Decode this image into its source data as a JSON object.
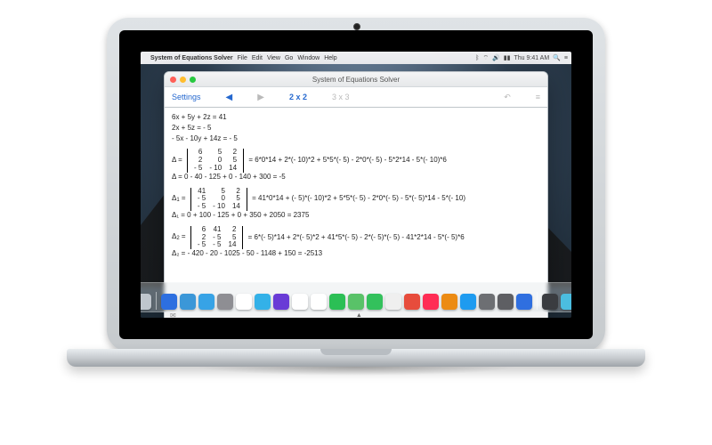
{
  "menubar": {
    "app_name": "System of Equations Solver",
    "menus": [
      "File",
      "Edit",
      "View",
      "Go",
      "Window",
      "Help"
    ],
    "right_status": {
      "time": "Thu 9:41 AM",
      "icons": [
        "bluetooth",
        "wifi",
        "speaker",
        "battery"
      ]
    }
  },
  "window": {
    "title": "System of Equations Solver",
    "toolbar": {
      "settings": "Settings",
      "back_icon": "◀",
      "fwd_icon": "▶",
      "mode_active": "2 x 2",
      "mode_inactive": "3 x 3",
      "undo_icon": "↶",
      "more_icon": "≡"
    },
    "content": {
      "system": [
        "6x + 5y + 2z = 41",
        "2x + 5z = - 5",
        "- 5x - 10y + 14z = - 5"
      ],
      "delta": {
        "label": "Δ =",
        "matrix": [
          [
            "6",
            "5",
            "2"
          ],
          [
            "2",
            "0",
            "5"
          ],
          [
            "- 5",
            "- 10",
            "14"
          ]
        ],
        "expansion": "= 6*0*14 + 2*(- 10)*2 + 5*5*(- 5) - 2*0*(- 5) - 5*2*14 - 5*(- 10)*6",
        "result": "Δ = 0 - 40 - 125 + 0 - 140 + 300 = -5"
      },
      "delta1": {
        "label": "Δ",
        "sub": "1",
        "eq": " =",
        "matrix": [
          [
            "41",
            "5",
            "2"
          ],
          [
            "- 5",
            "0",
            "5"
          ],
          [
            "- 5",
            "- 10",
            "14"
          ]
        ],
        "expansion": "= 41*0*14 + (- 5)*(- 10)*2 + 5*5*(- 5) - 2*0*(- 5) - 5*(- 5)*14 - 5*(- 10)",
        "result": "Δ₁ = 0 + 100 - 125 + 0 + 350 + 2050 = 2375"
      },
      "delta2": {
        "label": "Δ",
        "sub": "2",
        "eq": " =",
        "matrix": [
          [
            "6",
            "41",
            "2"
          ],
          [
            "2",
            "- 5",
            "5"
          ],
          [
            "- 5",
            "- 5",
            "14"
          ]
        ],
        "expansion": "= 6*(- 5)*14 + 2*(- 5)*2 + 41*5*(- 5) - 2*(- 5)*(- 5) - 41*2*14 - 5*(- 5)*6",
        "result": "Δ₂ = - 420 - 20 - 1025 - 50 - 1148 + 150 = -2513"
      }
    },
    "status": {
      "mail_icon": "✉",
      "expand_icon": "▲"
    }
  },
  "dock_colors": [
    "#bfc6cd",
    "#2d6fe0",
    "#3b97d8",
    "#37a3e6",
    "#8e8e93",
    "#ffffff",
    "#33b1e8",
    "#693bd6",
    "#ffffff",
    "#ffffff",
    "#2bbf55",
    "#59c268",
    "#33c15c",
    "#efefef",
    "#e74c3c",
    "#ff2d55",
    "#ec8b13",
    "#1e9bf0",
    "#6d6f73",
    "#5e5f63",
    "#2f6fe0",
    "#3a3c40",
    "#4bbde0"
  ]
}
